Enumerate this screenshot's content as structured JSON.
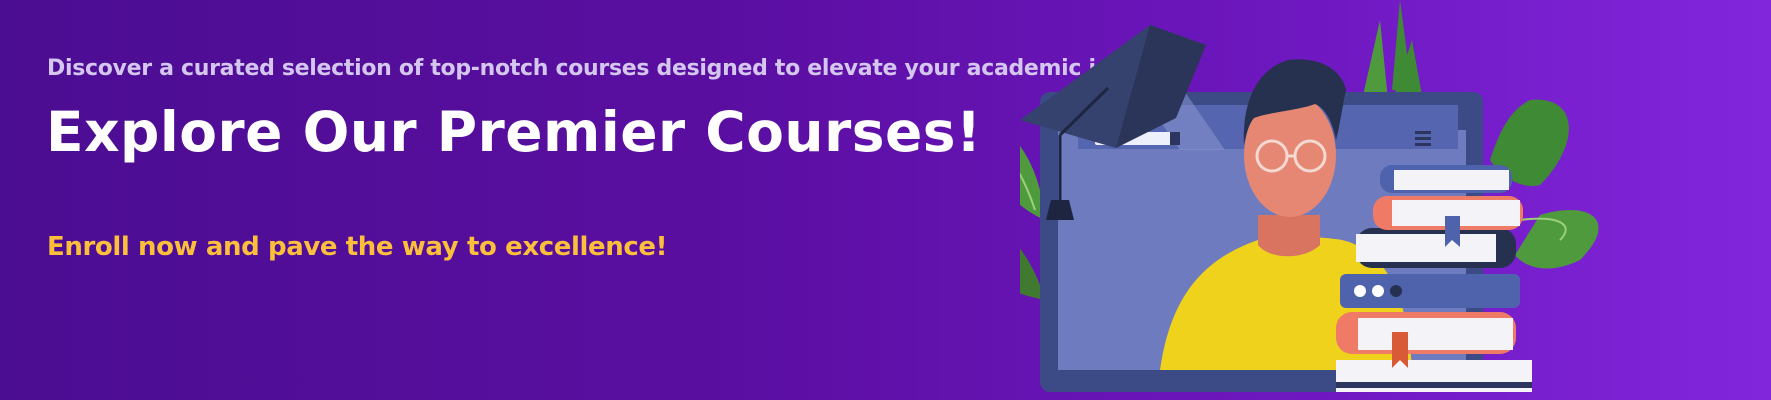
{
  "banner": {
    "tagline": "Discover a curated selection of top-notch courses designed to elevate your academic journey",
    "headline": "Explore Our Premier Courses!",
    "cta_text": "Enroll now and pave the way to excellence!"
  },
  "colors": {
    "background_start": "#4b0d92",
    "background_end": "#8226dc",
    "tagline": "#d4c6ef",
    "headline": "#ffffff",
    "cta": "#fcbf3c",
    "leaf": "#4f9a3c",
    "laptop_frame": "#3c4a86",
    "screen": "#6f7bbf",
    "shirt": "#efd21c",
    "skin": "#e58773",
    "books_red": "#ef7a66",
    "books_blue": "#4f63ad",
    "cap": "#34426d"
  },
  "illustration": {
    "subject": "online-learning",
    "icons": [
      "graduation-cap-icon",
      "laptop-icon",
      "student-avatar",
      "book-stack-icon",
      "plant-leaves"
    ]
  }
}
